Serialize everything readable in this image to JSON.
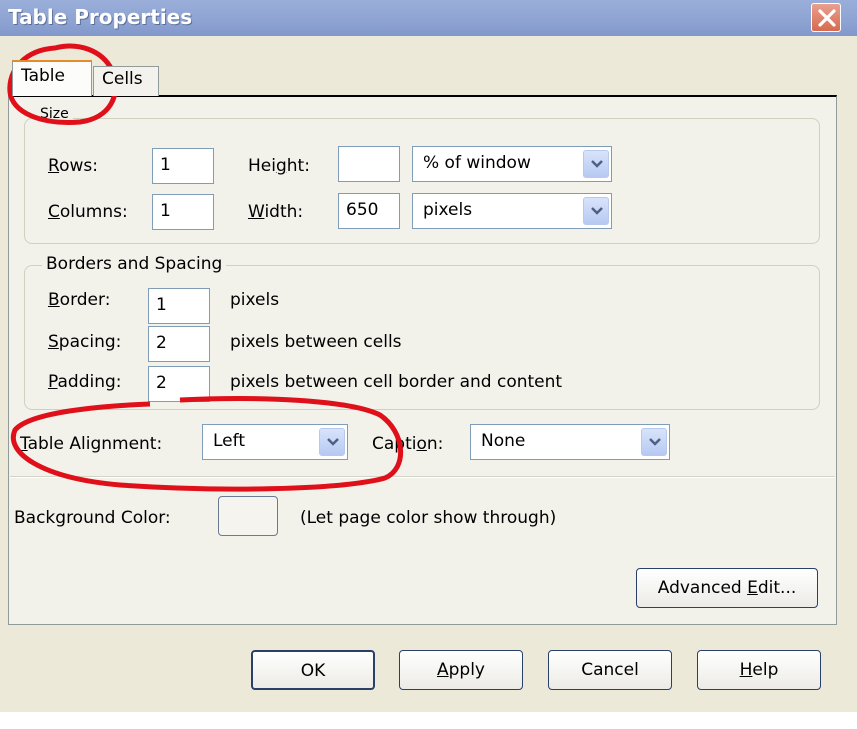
{
  "window": {
    "title": "Table Properties"
  },
  "tabs": [
    {
      "label": "Table"
    },
    {
      "label": "Cells"
    }
  ],
  "size": {
    "group_label": "Size",
    "rows_label": "Rows:",
    "rows_value": "1",
    "columns_label": "Columns:",
    "columns_value": "1",
    "height_label": "Height:",
    "height_value": "",
    "height_unit": "% of window",
    "width_label": "Width:",
    "width_value": "650",
    "width_unit": "pixels"
  },
  "borders": {
    "group_label": "Borders and Spacing",
    "border_label": "Border:",
    "border_value": "1",
    "border_unit": "pixels",
    "spacing_label": "Spacing:",
    "spacing_value": "2",
    "spacing_unit": "pixels between cells",
    "padding_label": "Padding:",
    "padding_value": "2",
    "padding_unit": "pixels between cell border and content"
  },
  "alignment": {
    "label": "Table Alignment:",
    "value": "Left",
    "caption_label": "Caption:",
    "caption_value": "None"
  },
  "background": {
    "label": "Background Color:",
    "note": "(Let page color show through)"
  },
  "buttons": {
    "advanced": "Advanced Edit...",
    "ok": "OK",
    "apply": "Apply",
    "cancel": "Cancel",
    "help": "Help"
  },
  "colors": {
    "titlebar": "#8ea3d2",
    "dialog": "#ece9d8",
    "annotation": "#e0101a"
  }
}
